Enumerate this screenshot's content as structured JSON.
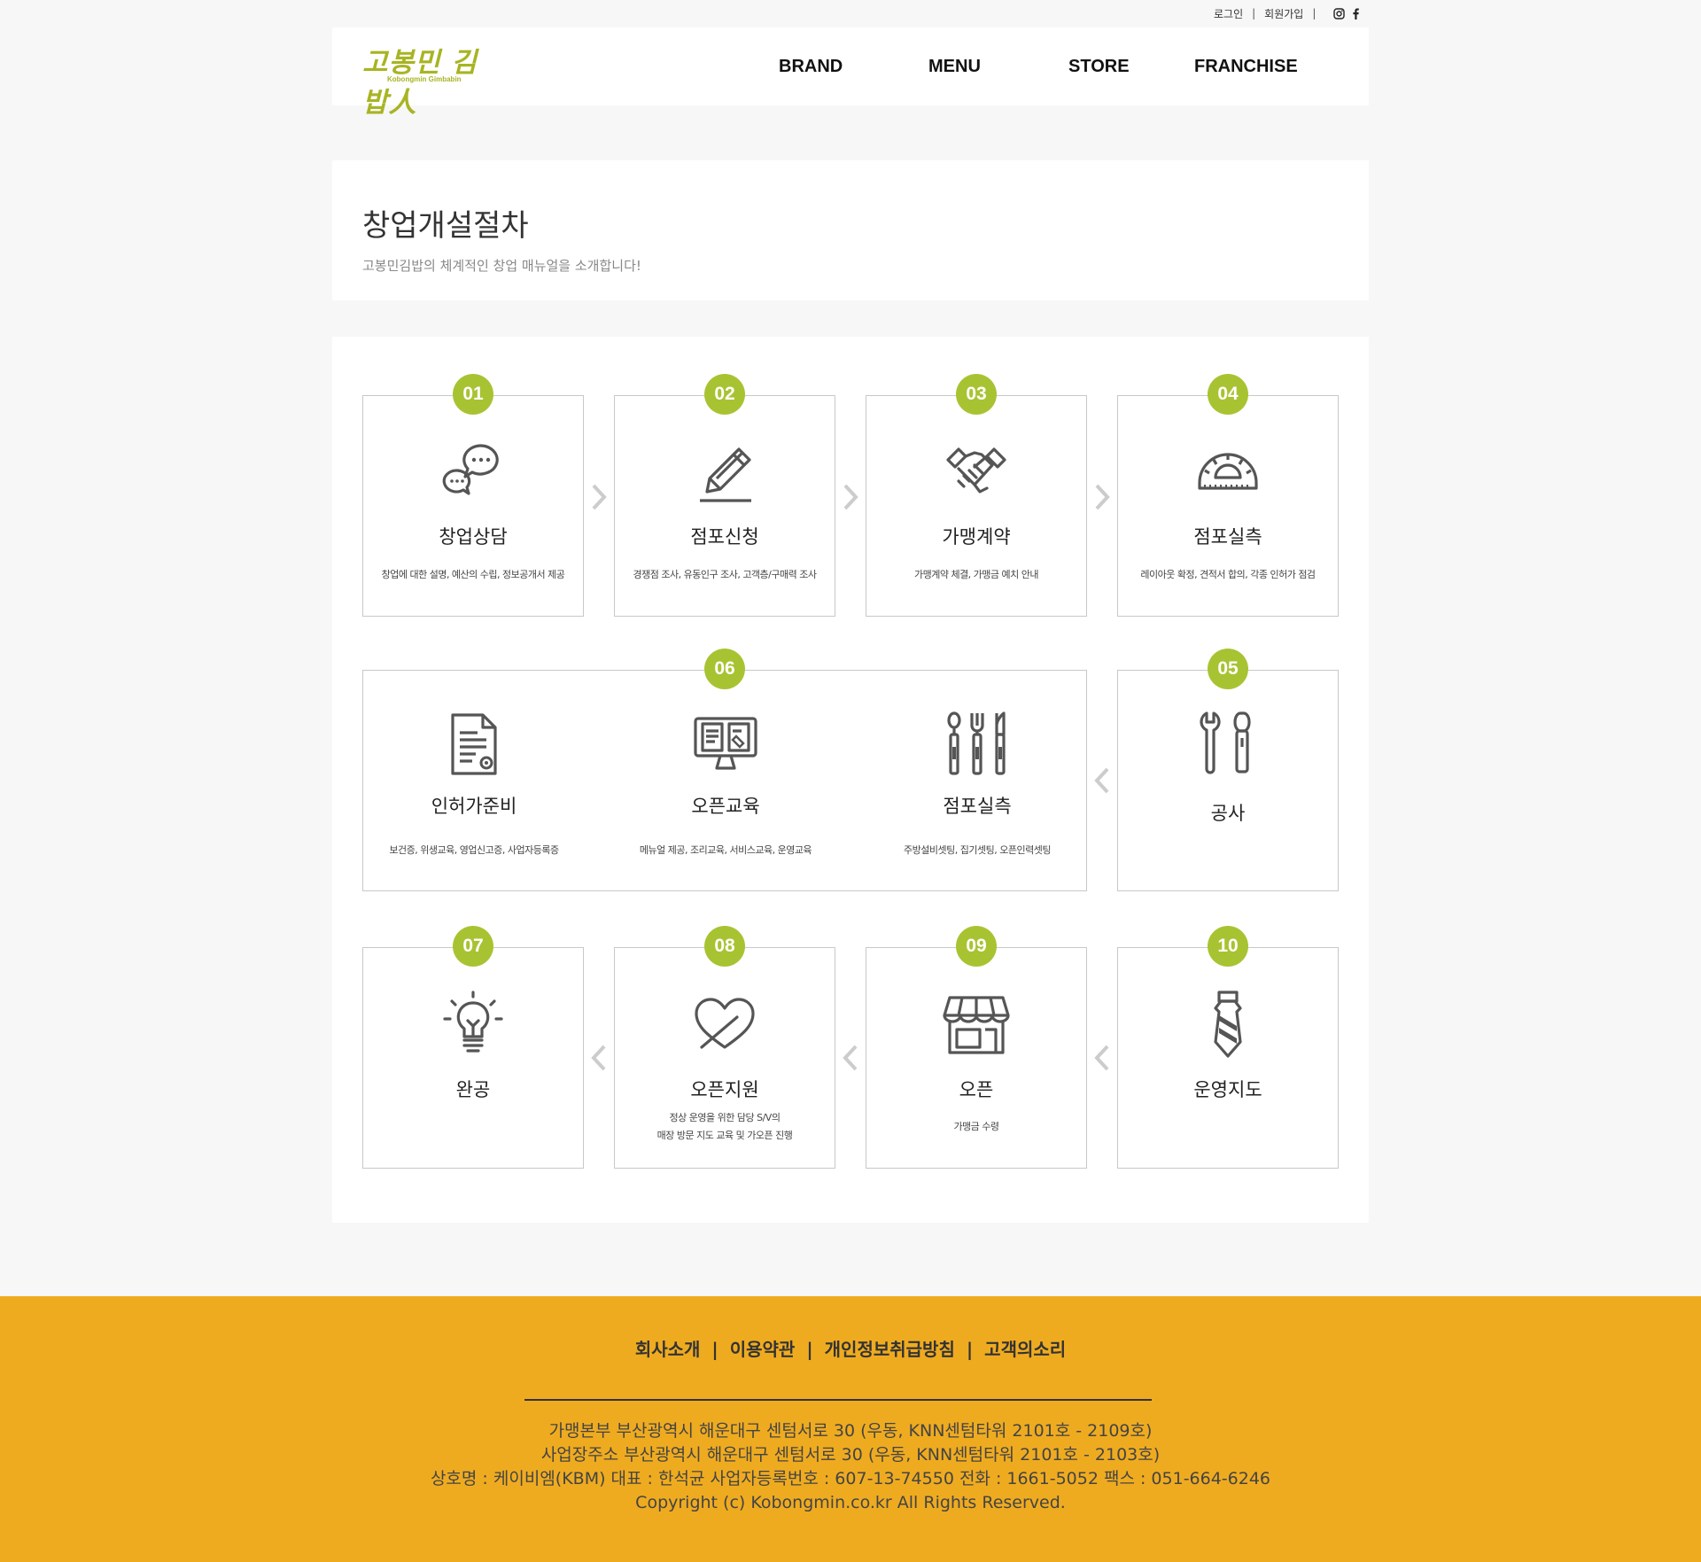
{
  "topbar": {
    "login": "로그인",
    "separator": "|",
    "signup": "회원가입"
  },
  "header": {
    "logo_ko": "고봉민 김밥人",
    "logo_en": "Kobongmin Gimbabin",
    "nav": [
      "BRAND",
      "MENU",
      "STORE",
      "FRANCHISE"
    ]
  },
  "intro": {
    "title": "창업개설절차",
    "subtitle": "고봉민김밥의 체계적인 창업 매뉴얼을 소개합니다!"
  },
  "steps": {
    "s01": {
      "num": "01",
      "title": "창업상담",
      "desc": "창업에 대한 설명, 예산의 수립, 정보공개서 제공",
      "icon": "chat-bubbles-icon"
    },
    "s02": {
      "num": "02",
      "title": "점포신청",
      "desc": "경쟁점 조사, 유동인구 조사, 고객층/구매력 조사",
      "icon": "pencil-icon"
    },
    "s03": {
      "num": "03",
      "title": "가맹계약",
      "desc": "가맹계약 체결, 가맹금 예치 안내",
      "icon": "handshake-icon"
    },
    "s04": {
      "num": "04",
      "title": "점포실측",
      "desc": "레이아웃 확정, 견적서 합의, 각종 인허가 점검",
      "icon": "protractor-icon"
    },
    "s05": {
      "num": "05",
      "title": "공사",
      "desc": "",
      "icon": "tools-icon"
    },
    "s06": {
      "num": "06",
      "items": [
        {
          "title": "인허가준비",
          "desc": "보건증, 위생교육, 영업신고증, 사업자등록증",
          "icon": "document-gear-icon"
        },
        {
          "title": "오픈교육",
          "desc": "메뉴얼 제공, 조리교육, 서비스교육, 운영교육",
          "icon": "manual-screen-icon"
        },
        {
          "title": "점포실측",
          "desc": "주방설비셋팅, 집기셋팅, 오픈인력셋팅",
          "icon": "kitchen-utensils-icon"
        }
      ]
    },
    "s07": {
      "num": "07",
      "title": "완공",
      "desc": "",
      "icon": "lightbulb-icon"
    },
    "s08": {
      "num": "08",
      "title": "오픈지원",
      "desc1": "정상 운영을 위한 담당 S/V의",
      "desc2": "매장 방문 지도 교육 및 가오픈 진행",
      "icon": "heart-icon"
    },
    "s09": {
      "num": "09",
      "title": "오픈",
      "desc": "가맹금 수령",
      "icon": "storefront-icon"
    },
    "s10": {
      "num": "10",
      "title": "운영지도",
      "desc": "",
      "icon": "necktie-icon"
    }
  },
  "footer": {
    "links": [
      "회사소개",
      "이용약관",
      "개인정보취급방침",
      "고객의소리"
    ],
    "separator": "|",
    "info": [
      "가맹본부 부산광역시 해운대구 센텀서로 30 (우동, KNN센텀타워 2101호 - 2109호)",
      "사업장주소 부산광역시 해운대구 센텀서로 30 (우동, KNN센텀타워 2101호 - 2103호)",
      "상호명 : 케이비엠(KBM) 대표 : 한석균 사업자등록번호 : 607-13-74550 전화 : 1661-5052 팩스 : 051-664-6246",
      "Copyright (c) Kobongmin.co.kr All Rights Reserved."
    ]
  },
  "colors": {
    "accent_green": "#a8c332",
    "footer_bg": "#efab20",
    "logo": "#a8b423"
  }
}
